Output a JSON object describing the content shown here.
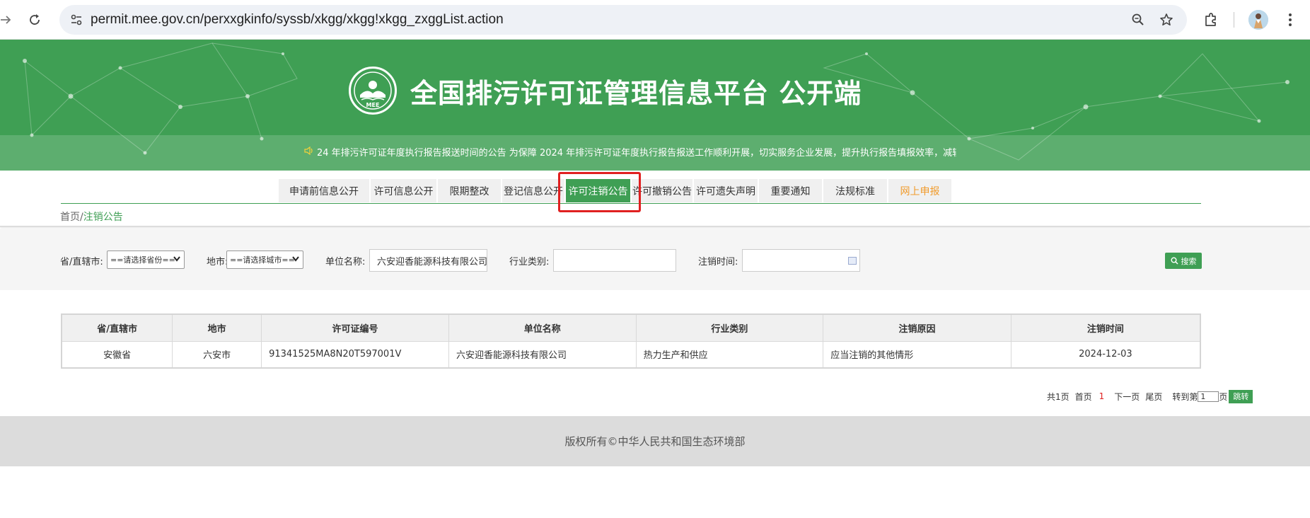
{
  "browser": {
    "url": "permit.mee.gov.cn/perxxgkinfo/syssb/xkgg/xkgg!xkgg_zxggList.action",
    "icons": [
      "forward-icon",
      "reload-icon",
      "site-info-icon",
      "zoom-icon",
      "bookmark-star-icon",
      "extensions-icon",
      "profile-avatar",
      "menu-kebab-icon"
    ]
  },
  "banner": {
    "title": "全国排污许可证管理信息平台  公开端",
    "logo_text": "MEE",
    "ticker": "24 年排污许可证年度执行报告报送时间的公告 为保障 2024 年排污许可证年度执行报告报送工作顺利开展，切实服务企业发展，提升执行报告填报效率，减轻基层管理人员负担"
  },
  "nav": {
    "tabs": [
      {
        "label": "申请前信息公开",
        "active": false
      },
      {
        "label": "许可信息公开",
        "active": false
      },
      {
        "label": "限期整改",
        "active": false
      },
      {
        "label": "登记信息公开",
        "active": false
      },
      {
        "label": "许可注销公告",
        "active": true
      },
      {
        "label": "许可撤销公告",
        "active": false
      },
      {
        "label": "许可遗失声明",
        "active": false
      },
      {
        "label": "重要通知",
        "active": false
      },
      {
        "label": "法规标准",
        "active": false
      },
      {
        "label": "网上申报",
        "active": false
      }
    ]
  },
  "breadcrumb": {
    "home": "首页",
    "separator": "/",
    "current": "注销公告"
  },
  "filters": {
    "province_label": "省/直辖市:",
    "province_value": "==请选择省份==",
    "city_label": "地市:",
    "city_value": "==请选择城市==",
    "company_label": "单位名称:",
    "company_value": "六安迎香能源科技有限公司",
    "industry_label": "行业类别:",
    "industry_value": "",
    "date_label": "注销时间:",
    "date_value": "",
    "search_label": "搜索"
  },
  "table": {
    "headers": [
      "省/直辖市",
      "地市",
      "许可证编号",
      "单位名称",
      "行业类别",
      "注销原因",
      "注销时间"
    ],
    "rows": [
      {
        "province": "安徽省",
        "city": "六安市",
        "permit_no": "91341525MA8N20T597001V",
        "company": "六安迎香能源科技有限公司",
        "industry": "热力生产和供应",
        "reason": "应当注销的其他情形",
        "date": "2024-12-03"
      }
    ]
  },
  "pager": {
    "total": "共1页",
    "first": "首页",
    "current": "1",
    "next": "下一页",
    "last": "尾页",
    "goto_label": "转到第",
    "goto_value": "1",
    "page_suffix": "页",
    "go_button": "跳转"
  },
  "footer": {
    "copyright": "版权所有©中华人民共和国生态环境部"
  },
  "colors": {
    "brand_green": "#3f9f54",
    "highlight_red": "#e02020",
    "orange_tab": "#f19b2c"
  }
}
